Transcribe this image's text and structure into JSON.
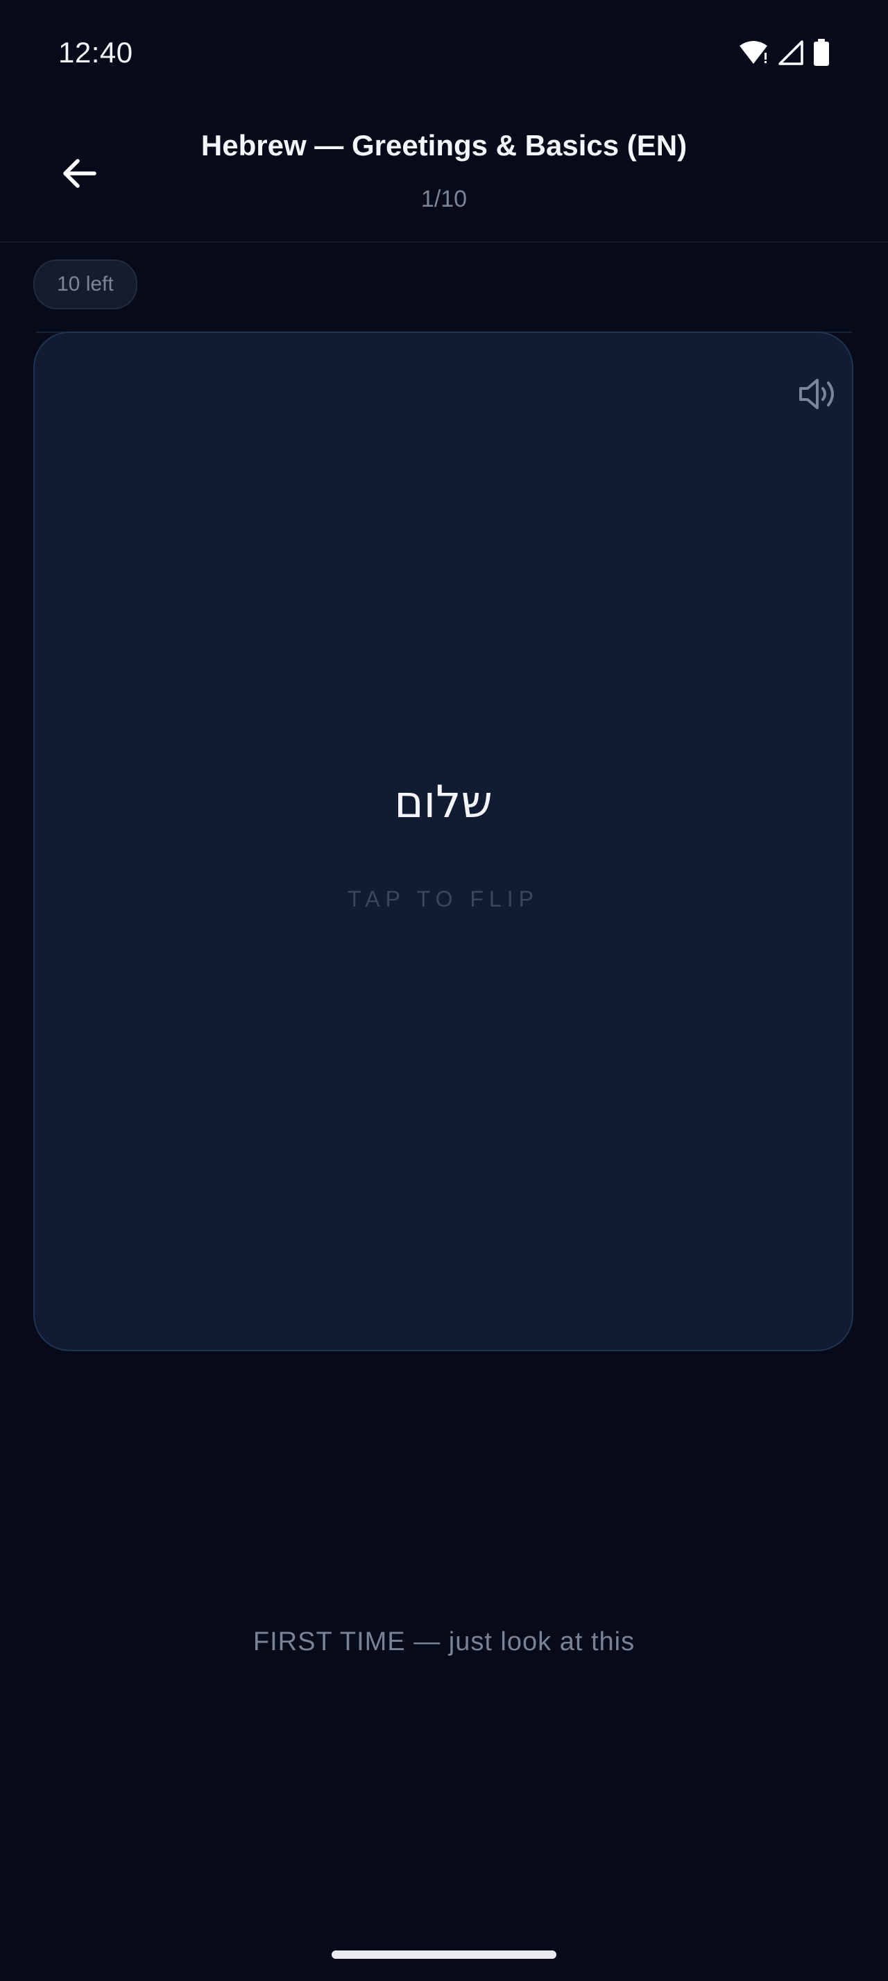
{
  "status_bar": {
    "time": "12:40",
    "icons": [
      "wifi-icon",
      "cell-signal-icon",
      "battery-icon"
    ]
  },
  "app_bar": {
    "back_icon": "arrow-left-icon",
    "title": "Hebrew — Greetings & Basics (EN)",
    "progress": "1/10"
  },
  "remaining_chip": {
    "label": "10 left"
  },
  "card": {
    "word": "שלום",
    "hint": "TAP TO FLIP",
    "audio_icon": "speaker-icon"
  },
  "footer": {
    "message": "FIRST TIME — just look at this"
  },
  "colors": {
    "background": "#070b19",
    "card": "#111c33",
    "card_border": "#1e3452",
    "muted_text": "#7a8296"
  }
}
